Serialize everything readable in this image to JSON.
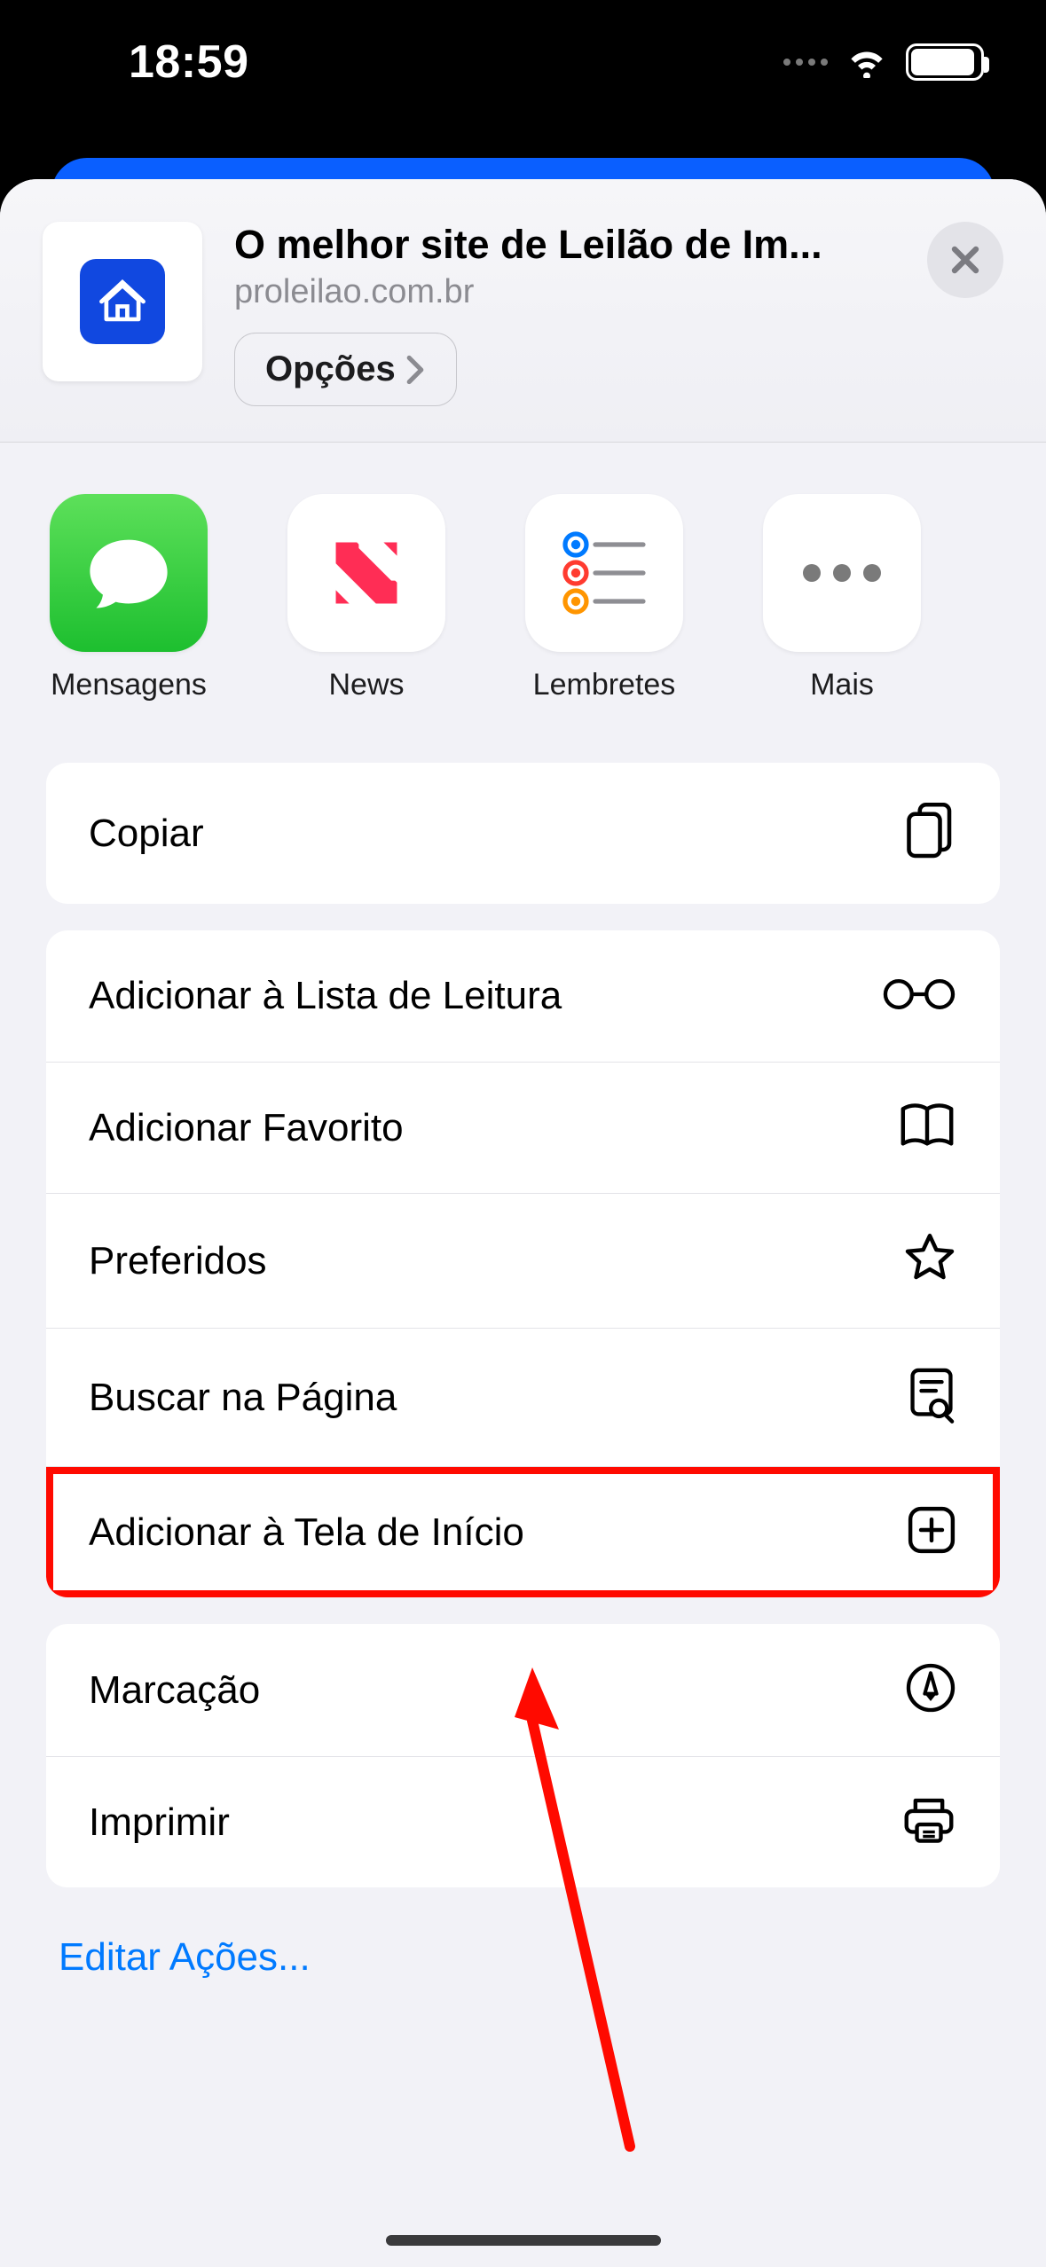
{
  "statusbar": {
    "time": "18:59"
  },
  "header": {
    "title": "O melhor site de Leilão de Im...",
    "url": "proleilao.com.br",
    "options_label": "Opções"
  },
  "apps": [
    {
      "id": "messages",
      "label": "Mensagens"
    },
    {
      "id": "news",
      "label": "News"
    },
    {
      "id": "reminders",
      "label": "Lembretes"
    },
    {
      "id": "more",
      "label": "Mais"
    }
  ],
  "actions": {
    "group1": [
      {
        "id": "copy",
        "label": "Copiar",
        "icon": "copy-icon"
      }
    ],
    "group2": [
      {
        "id": "reading-list",
        "label": "Adicionar à Lista de Leitura",
        "icon": "glasses-icon"
      },
      {
        "id": "add-bookmark",
        "label": "Adicionar Favorito",
        "icon": "book-icon"
      },
      {
        "id": "favorites",
        "label": "Preferidos",
        "icon": "star-icon"
      },
      {
        "id": "find-on-page",
        "label": "Buscar na Página",
        "icon": "page-search-icon"
      },
      {
        "id": "add-home",
        "label": "Adicionar à Tela de Início",
        "icon": "plus-app-icon",
        "highlight": true
      }
    ],
    "group3": [
      {
        "id": "markup",
        "label": "Marcação",
        "icon": "markup-icon"
      },
      {
        "id": "print",
        "label": "Imprimir",
        "icon": "printer-icon"
      }
    ],
    "edit_label": "Editar Ações..."
  }
}
